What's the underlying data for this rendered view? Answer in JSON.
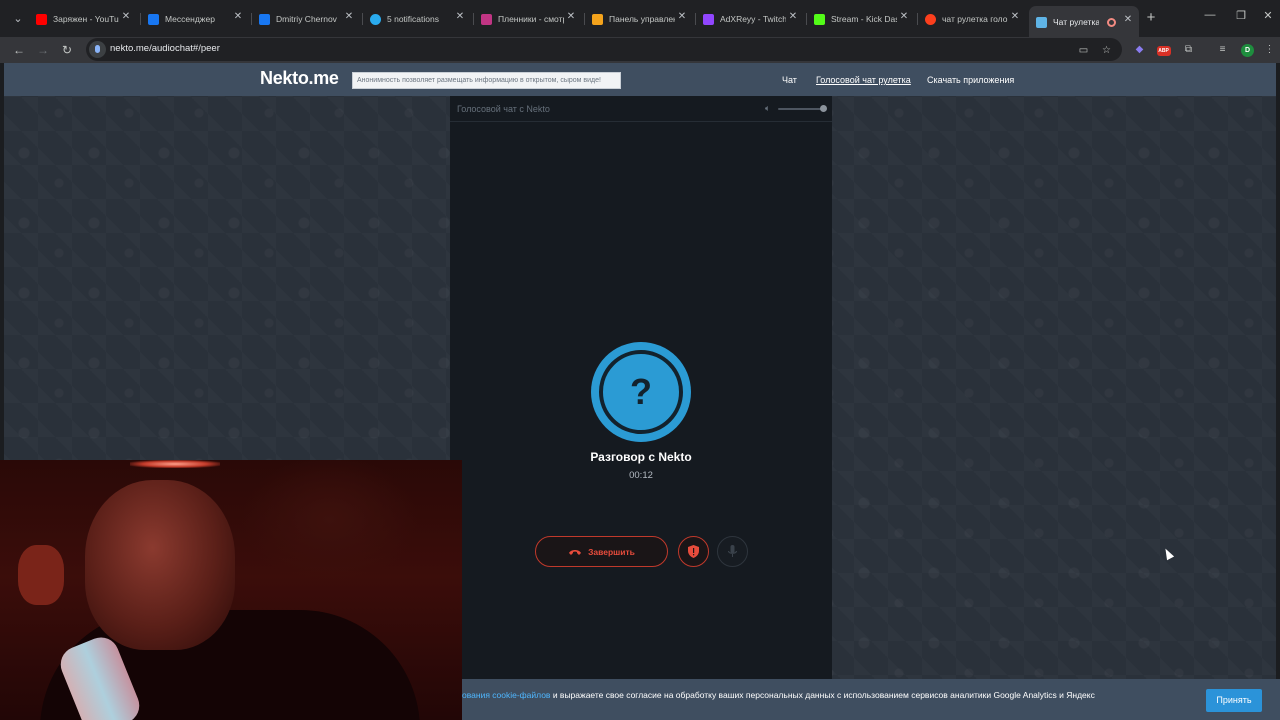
{
  "browser": {
    "tabs": [
      {
        "title": "Заряжен - YouTube",
        "favicon_color": "#ff0000",
        "favicon": "youtube-icon"
      },
      {
        "title": "Мессенджер",
        "favicon_color": "#1877f2",
        "favicon": "messenger-icon"
      },
      {
        "title": "Dmitriy Chernov",
        "favicon_color": "#1877f2",
        "favicon": "profile-icon"
      },
      {
        "title": "5 notifications",
        "favicon_color": "#2aabee",
        "favicon": "telegram-icon"
      },
      {
        "title": "Пленники - смотр...",
        "favicon_color": "#c13584",
        "favicon": "media-icon"
      },
      {
        "title": "Панель управлен...",
        "favicon_color": "#f4a31c",
        "favicon": "panel-icon"
      },
      {
        "title": "AdXReyy - Twitch",
        "favicon_color": "#9146ff",
        "favicon": "twitch-icon"
      },
      {
        "title": "Stream - Kick Dash...",
        "favicon_color": "#53fc18",
        "favicon": "kick-icon"
      },
      {
        "title": "чат рулетка голо...",
        "favicon_color": "#fc3f1d",
        "favicon": "yandex-icon"
      },
      {
        "title": "Чат рулетка",
        "favicon_color": "#5fb4e6",
        "favicon": "nekto-icon",
        "active": true
      }
    ],
    "close_glyph": "✕",
    "new_tab_glyph": "+",
    "url": "nekto.me/audiochat#/peer",
    "nav": {
      "back": "←",
      "forward": "→",
      "reload": "↻"
    },
    "window_controls": {
      "minimize": "—",
      "restore": "❐",
      "close": "✕"
    },
    "toolbar_icons": [
      "cast-icon",
      "bookmark-star-icon",
      "extension-icon",
      "adblock-icon",
      "puzzle-icon",
      "reading-list-icon",
      "profile-avatar-icon",
      "kebab-menu-icon"
    ],
    "profile_initial": "D",
    "adblock_label": "ABP"
  },
  "site": {
    "logo": "Nekto.me",
    "slogan": "Анонимность позволяет размещать информацию в открытом, сыром виде!",
    "nav": [
      {
        "label": "Чат",
        "current": false
      },
      {
        "label": "Голосовой чат рулетка",
        "current": true
      },
      {
        "label": "Скачать приложения",
        "current": false
      }
    ]
  },
  "chat": {
    "panel_title": "Голосовой чат с Nekto",
    "volume_level": 1.0,
    "avatar_glyph": "?",
    "conversation_title": "Разговор с Nekto",
    "timer": "00:12",
    "end_button": "Завершить"
  },
  "cookie": {
    "link_text": "ования cookie-файлов",
    "text": " и выражаете свое согласие на обработку ваших персональных данных с использованием сервисов аналитики Google Analytics и Яндекс",
    "accept_button": "Принять"
  },
  "colors": {
    "header": "#3f4e60",
    "accent_blue": "#2b9bd4",
    "danger_red": "#c0392b",
    "panel_bg": "#151a20"
  }
}
